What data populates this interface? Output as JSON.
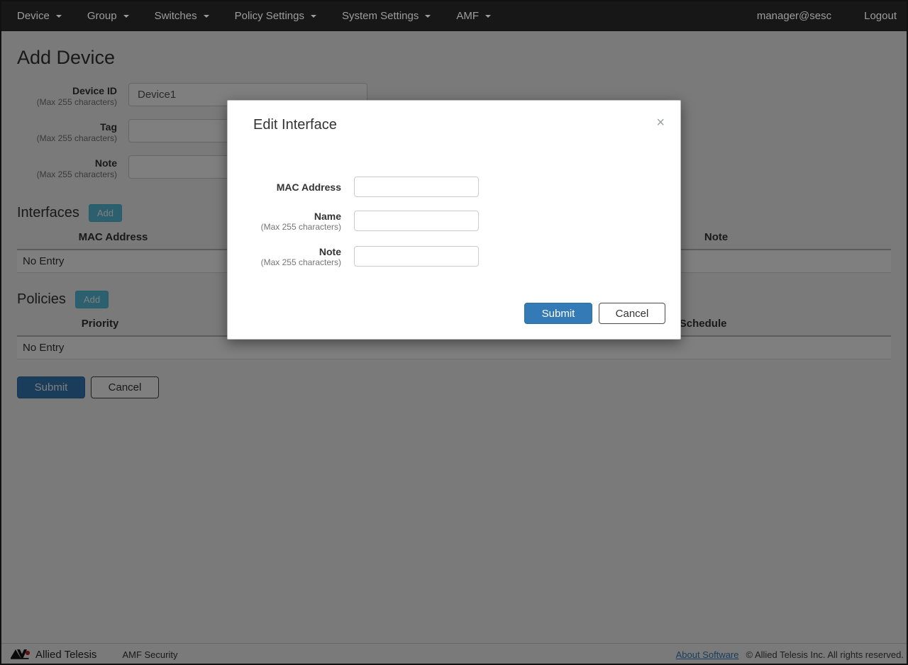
{
  "navbar": {
    "items": [
      "Device",
      "Group",
      "Switches",
      "Policy Settings",
      "System Settings",
      "AMF"
    ],
    "user": "manager@sesc",
    "logout": "Logout"
  },
  "page": {
    "title": "Add Device",
    "form": {
      "fields": [
        {
          "label": "Device ID",
          "hint": "(Max 255 characters)",
          "value": "Device1"
        },
        {
          "label": "Tag",
          "hint": "(Max 255 characters)",
          "value": ""
        },
        {
          "label": "Note",
          "hint": "(Max 255 characters)",
          "value": ""
        }
      ]
    },
    "interfaces": {
      "heading": "Interfaces",
      "add_label": "Add",
      "columns": [
        "MAC Address",
        "",
        "Note"
      ],
      "empty_text": "No Entry"
    },
    "policies": {
      "heading": "Policies",
      "add_label": "Add",
      "columns": [
        "Priority",
        "",
        "Schedule"
      ],
      "empty_text": "No Entry"
    },
    "submit_label": "Submit",
    "cancel_label": "Cancel"
  },
  "modal": {
    "title": "Edit Interface",
    "close_icon": "×",
    "fields": [
      {
        "label": "MAC Address",
        "hint": "",
        "value": ""
      },
      {
        "label": "Name",
        "hint": "(Max 255 characters)",
        "value": ""
      },
      {
        "label": "Note",
        "hint": "(Max 255 characters)",
        "value": ""
      }
    ],
    "submit_label": "Submit",
    "cancel_label": "Cancel"
  },
  "footer": {
    "brand": "Allied Telesis",
    "product": "AMF Security",
    "about_link": "About Software",
    "copyright": "© Allied Telesis Inc. All rights reserved."
  },
  "colors": {
    "navbar_bg": "#171717",
    "navbar_text": "#9d9d9d",
    "primary_button": "#337ab7",
    "add_button": "#5bc0de",
    "link": "#337ab7",
    "logo_red": "#c1272d",
    "backdrop": "rgba(0,0,0,0.5)"
  }
}
